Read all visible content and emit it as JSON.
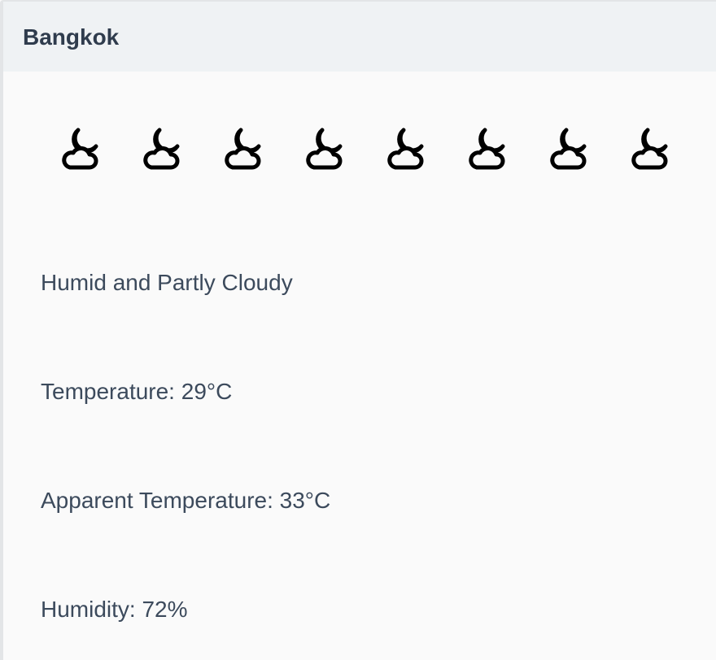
{
  "city": "Bangkok",
  "icons": [
    "partly-cloudy-night-icon",
    "partly-cloudy-night-icon",
    "partly-cloudy-night-icon",
    "partly-cloudy-night-icon",
    "partly-cloudy-night-icon",
    "partly-cloudy-night-icon",
    "partly-cloudy-night-icon",
    "partly-cloudy-night-icon"
  ],
  "summary": "Humid and Partly Cloudy",
  "temperature": "Temperature: 29°C",
  "apparent_temperature": "Apparent Temperature: 33°C",
  "humidity": "Humidity: 72%",
  "colors": {
    "header_bg": "#eff2f4",
    "card_bg": "#fafafa",
    "title_text": "#2f3c4d",
    "body_text": "#3c4a5c",
    "icon": "#000000"
  }
}
